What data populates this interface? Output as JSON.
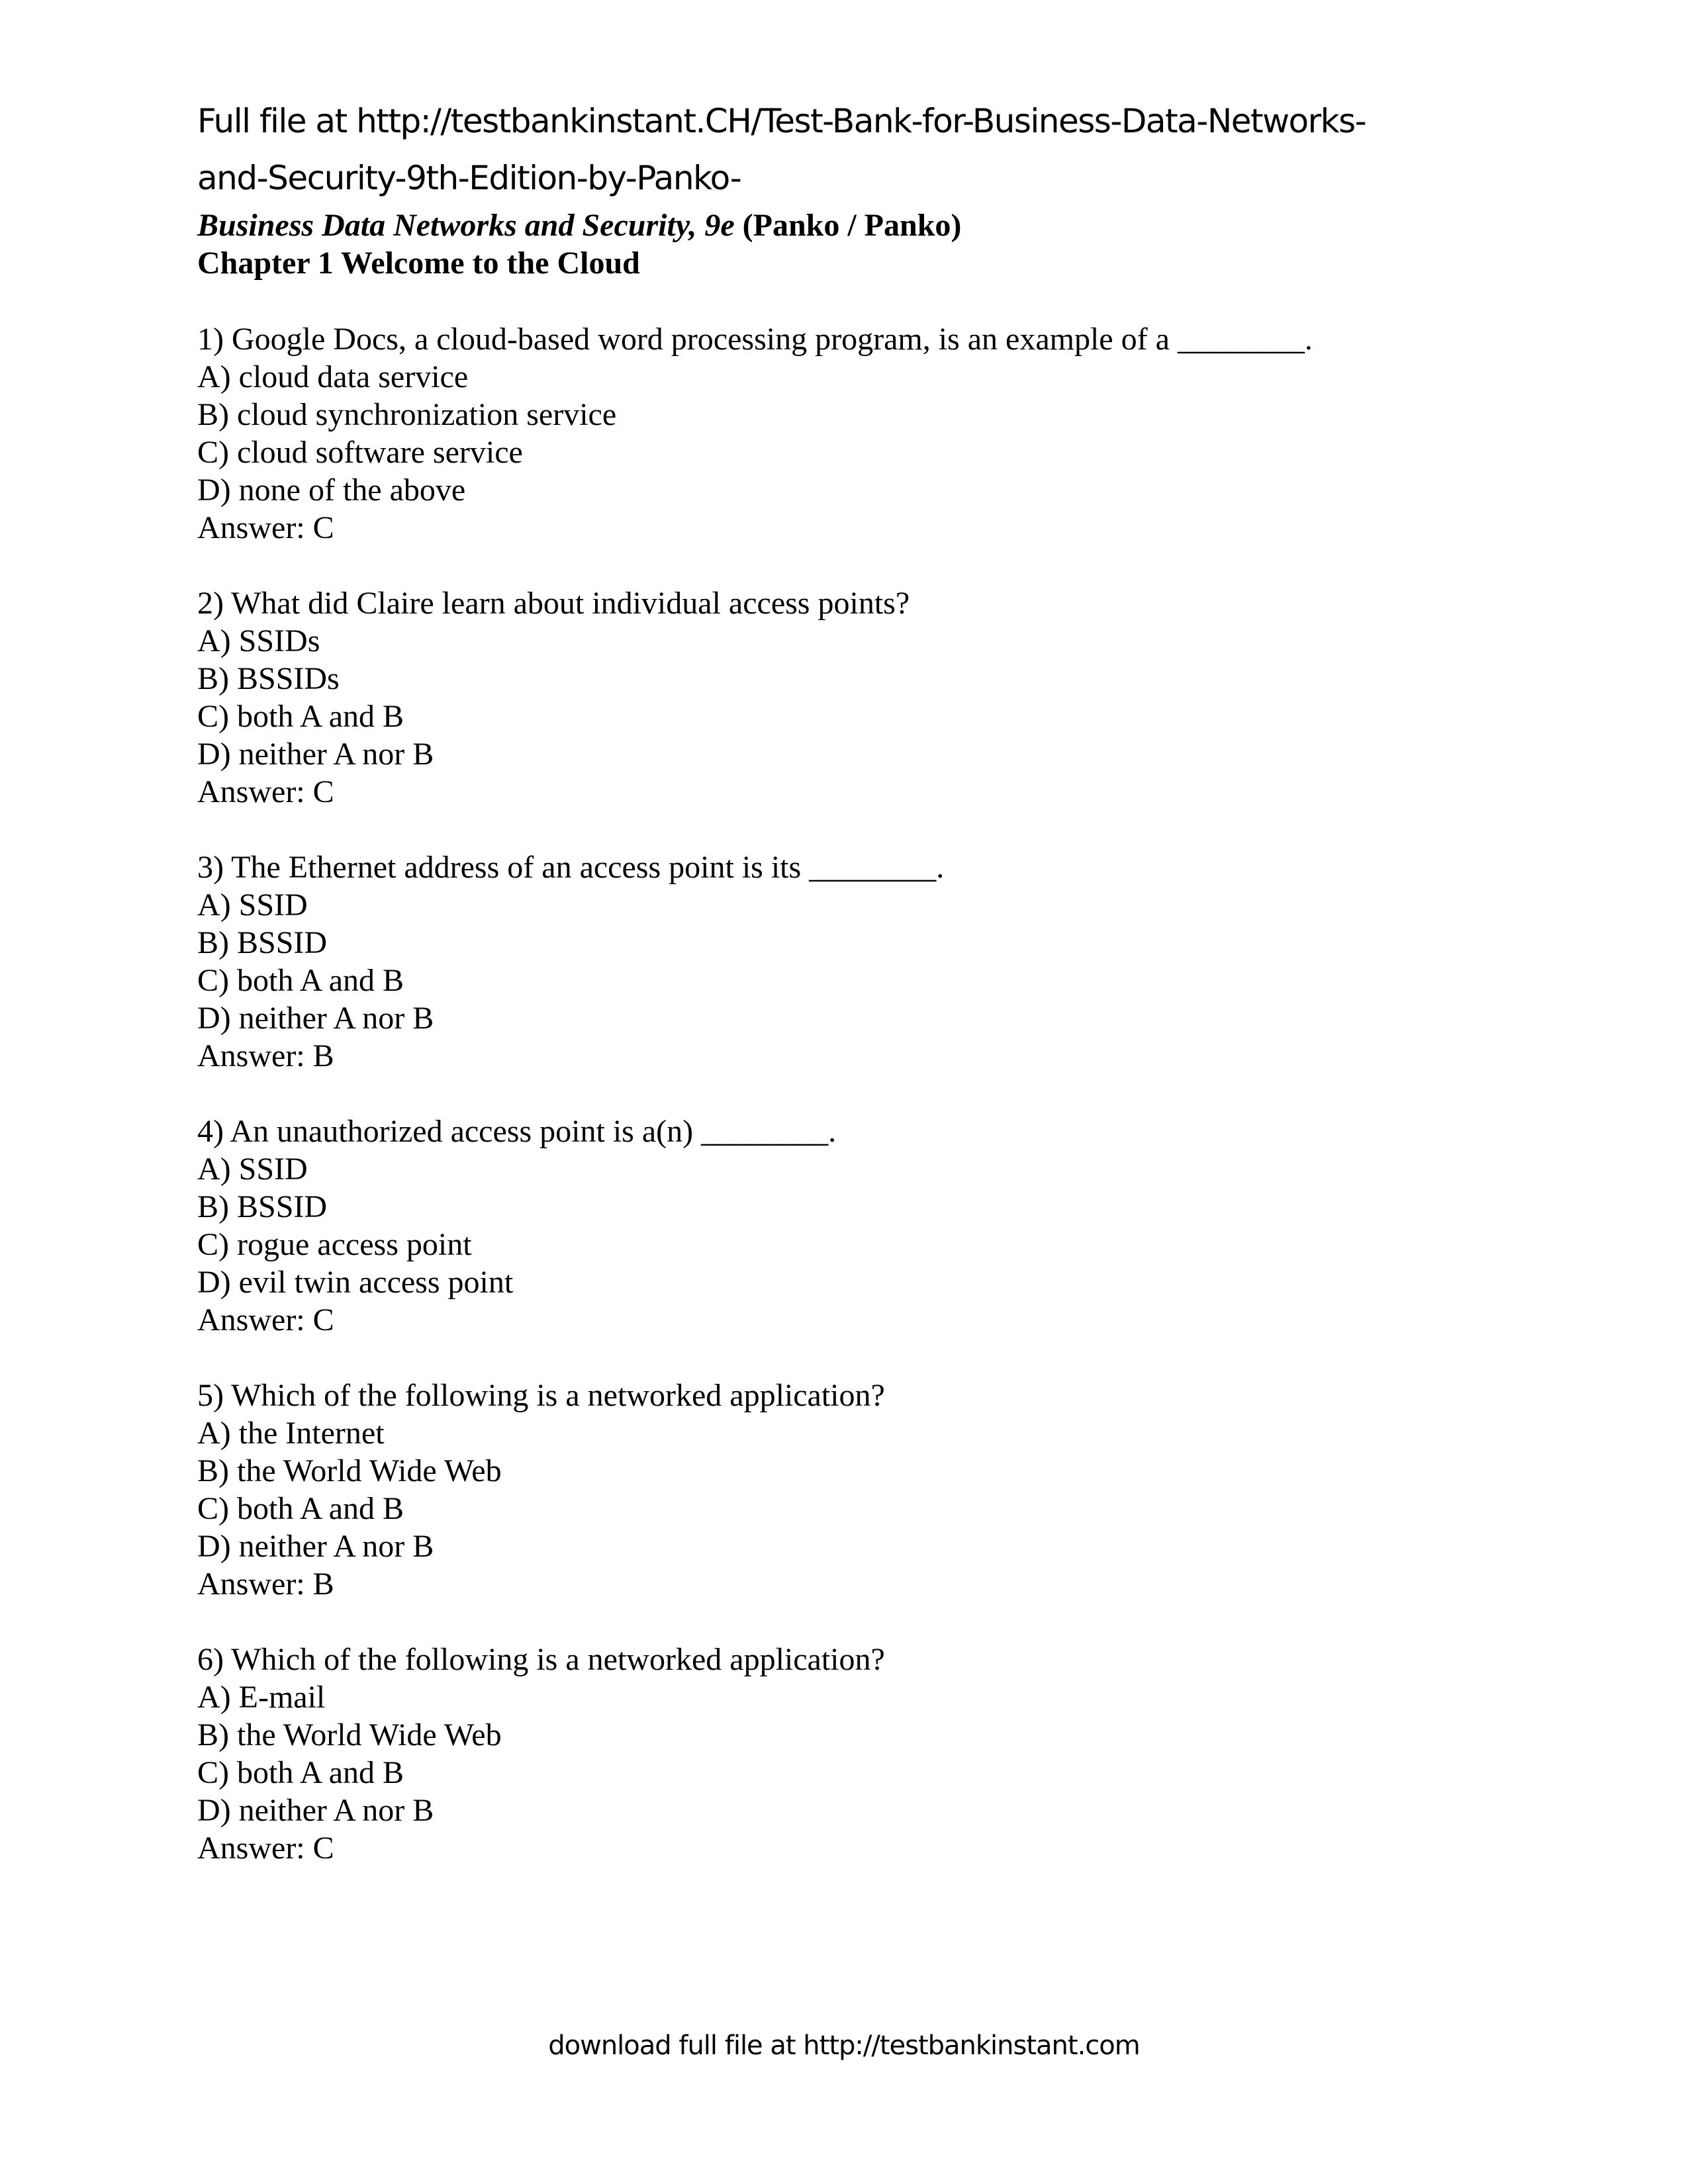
{
  "header": {
    "link_line1": "Full file at http://testbankinstant.CH/Test-Bank-for-Business-Data-Networks-",
    "link_line2": "and-Security-9th-Edition-by-Panko-",
    "book_title_italic": "Business Data Networks and Security, 9e",
    "book_authors": " (Panko / Panko)",
    "chapter": "Chapter 1  Welcome to the Cloud"
  },
  "questions": [
    {
      "stem": "1) Google Docs, a cloud-based word processing program, is an example of a ________.",
      "options": [
        "A) cloud data service",
        "B) cloud synchronization service",
        "C) cloud software service",
        "D) none of the above"
      ],
      "answer": "Answer:  C"
    },
    {
      "stem": "2) What did Claire learn about individual access points?",
      "options": [
        "A) SSIDs",
        "B) BSSIDs",
        "C) both A and B",
        "D) neither A nor B"
      ],
      "answer": "Answer:  C"
    },
    {
      "stem": "3) The Ethernet address of an access point is its ________.",
      "options": [
        "A) SSID",
        "B) BSSID",
        "C) both A and B",
        "D) neither A nor B"
      ],
      "answer": "Answer:  B"
    },
    {
      "stem": "4) An unauthorized access point is a(n) ________.",
      "options": [
        "A) SSID",
        "B) BSSID",
        "C) rogue access point",
        "D) evil twin access point"
      ],
      "answer": "Answer:  C"
    },
    {
      "stem": "5) Which of the following is a networked application?",
      "options": [
        "A) the Internet",
        "B) the World Wide Web",
        "C) both A and B",
        "D) neither A nor B"
      ],
      "answer": "Answer:  B"
    },
    {
      "stem": "6) Which of the following is a networked application?",
      "options": [
        "A) E-mail",
        "B) the World Wide Web",
        "C) both A and B",
        "D) neither A nor B"
      ],
      "answer": "Answer:  C"
    }
  ],
  "footer": {
    "text": "download full file at http://testbankinstant.com"
  }
}
